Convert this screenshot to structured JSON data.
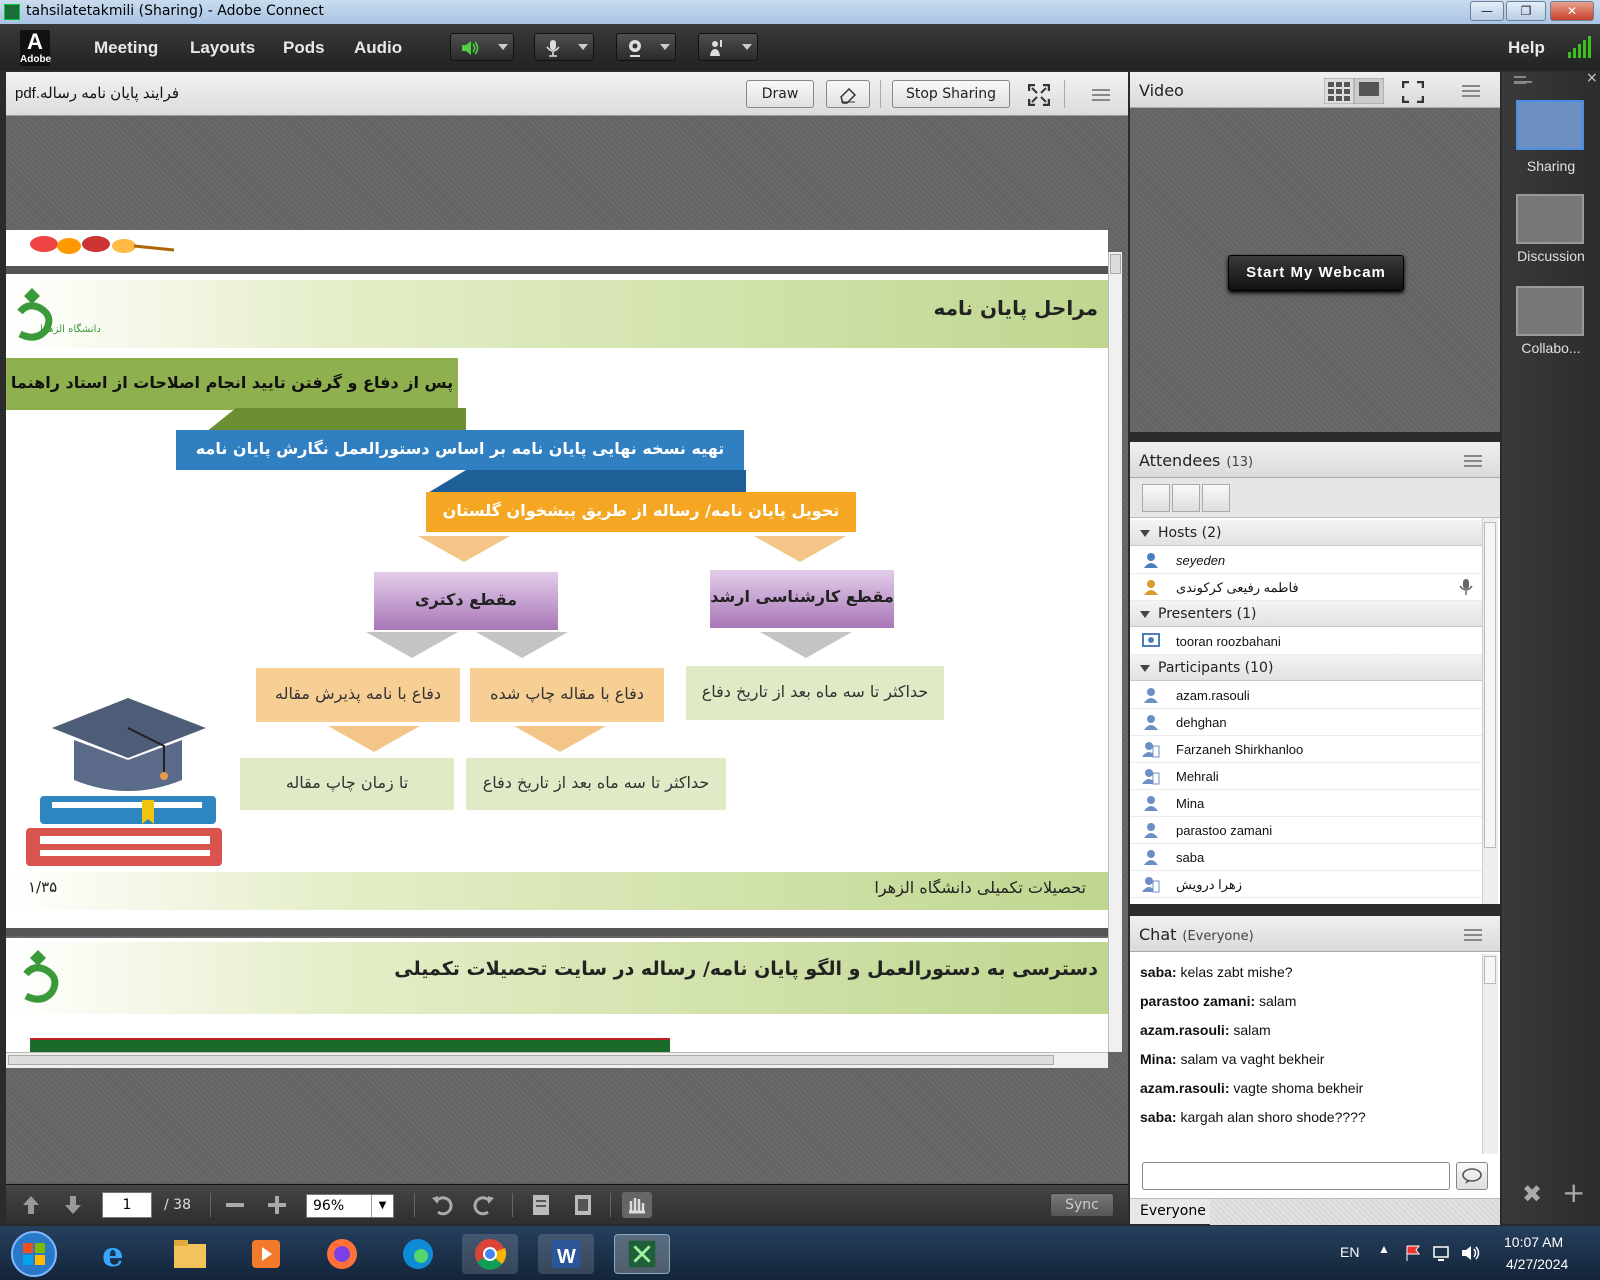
{
  "window": {
    "title": "tahsilatetakmili (Sharing) - Adobe Connect"
  },
  "menubar": {
    "logo_label": "Adobe",
    "items": [
      "Meeting",
      "Layouts",
      "Pods",
      "Audio"
    ],
    "help": "Help"
  },
  "share": {
    "filename": "فرایند پایان نامه رساله.pdf",
    "draw_label": "Draw",
    "stop_label": "Stop Sharing",
    "page_current": "1",
    "page_total": "/ 38",
    "zoom": "96%",
    "sync_label": "Sync"
  },
  "slide": {
    "title": "مراحل پایان نامه",
    "step1": "پس از دفاع و گرفتن تایید انجام اصلاحات از استاد راهنما",
    "step2": "تهیه نسخه نهایی پایان نامه بر اساس دستورالعمل نگارش پایان نامه دانشگاه",
    "step3": "تحویل پایان نامه/ رساله از طریق پیشخوان گلستان",
    "phd": "مقطع دکتری",
    "masters": "مقطع کارشناسی ارشد",
    "phd_opt1": "دفاع با نامه پذیرش مقاله",
    "phd_opt2": "دفاع با مقاله چاپ شده",
    "masters_deadline": "حداکثر تا سه ماه بعد از تاریخ دفاع",
    "phd_opt1_deadline": "تا زمان چاپ مقاله",
    "phd_opt2_deadline": "حداکثر تا سه ماه بعد از تاریخ دفاع",
    "footer_left": "۱/۳۵",
    "footer_right": "تحصیلات تکمیلی دانشگاه الزهرا",
    "logo_text": "دانشگاه الزهرا",
    "next_title": "دسترسی به دستورالعمل و الگو پایان نامه/ رساله در سایت تحصیلات تکمیلی"
  },
  "video": {
    "title": "Video",
    "webcam_label": "Start My Webcam"
  },
  "attendees": {
    "title": "Attendees",
    "count": "(13)",
    "groups": [
      {
        "label": "Hosts (2)",
        "people": [
          "seyeden",
          "فاطمه رفیعی کرکوندی"
        ]
      },
      {
        "label": "Presenters (1)",
        "people": [
          "tooran roozbahani"
        ]
      },
      {
        "label": "Participants (10)",
        "people": [
          "azam.rasouli",
          "dehghan",
          "Farzaneh Shirkhanloo",
          "Mehrali",
          "Mina",
          "parastoo zamani",
          "saba",
          "زهرا درویش"
        ]
      }
    ]
  },
  "chat": {
    "title": "Chat",
    "scope": "(Everyone)",
    "messages": [
      {
        "from": "saba:",
        "text": "kelas zabt mishe?"
      },
      {
        "from": "parastoo zamani:",
        "text": "salam"
      },
      {
        "from": "azam.rasouli:",
        "text": "salam"
      },
      {
        "from": "Mina:",
        "text": "salam va vaght bekheir"
      },
      {
        "from": "azam.rasouli:",
        "text": "vagte shoma bekheir"
      },
      {
        "from": "saba:",
        "text": "kargah alan shoro shode????"
      }
    ],
    "to_label": "Everyone"
  },
  "layouts": {
    "items": [
      "Sharing",
      "Discussion",
      "Collabo..."
    ]
  },
  "taskbar": {
    "lang": "EN",
    "time": "10:07 AM",
    "date": "4/27/2024"
  },
  "colors": {
    "step1_bg": "#8fb04f",
    "step2_bg": "#2f7fc1",
    "step3_bg": "#f5a623",
    "level_bg": "#c9a4d6",
    "option_bg": "#f7cf95",
    "deadline_bg": "#dfeac6"
  }
}
